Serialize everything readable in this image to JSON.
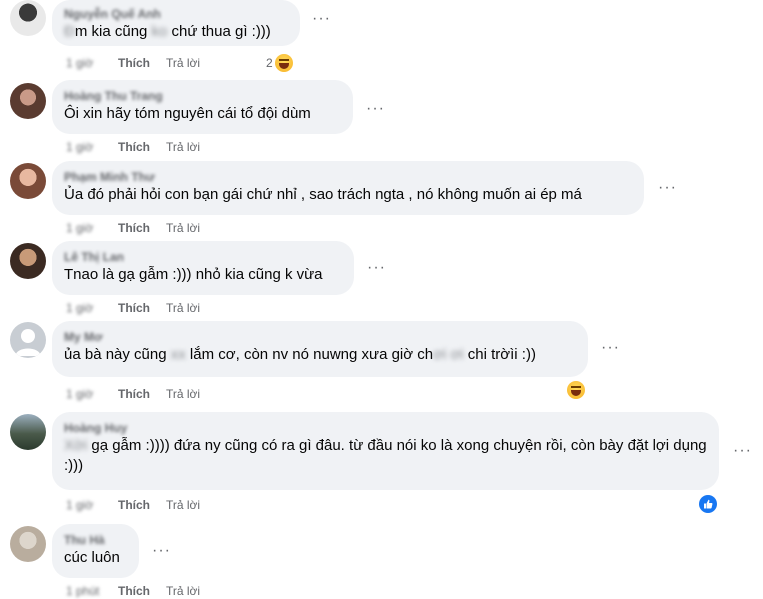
{
  "icons": {
    "more": "more-options-icon",
    "haha": "haha-reaction-icon",
    "like": "like-reaction-icon"
  },
  "labels": {
    "like": "Thích",
    "reply": "Trả lời",
    "more": "···"
  },
  "comments": [
    {
      "name": "Nguyễn Quế Anh",
      "text_parts": [
        {
          "t": "Đ",
          "b": true
        },
        {
          "t": "m kia cũng ",
          "b": false
        },
        {
          "t": "ko",
          "b": true
        },
        {
          "t": " chứ thua gì :)))",
          "b": false
        }
      ],
      "time": "1 giờ",
      "reaction_count": "2"
    },
    {
      "name": "Hoàng Thu Trang",
      "text_parts": [
        {
          "t": "Ôi xin hãy tóm nguyên cái tổ đội dùm",
          "b": false
        }
      ],
      "time": "1 giờ"
    },
    {
      "name": "Phạm Minh Thư",
      "text_parts": [
        {
          "t": "Ủa đó phải hỏi con bạn gái chứ nhỉ , sao trách ngta , nó không muốn ai ép má",
          "b": false
        }
      ],
      "time": "1 giờ"
    },
    {
      "name": "Lê Thị Lan",
      "text_parts": [
        {
          "t": "Tnao là gạ gẫm :))) nhỏ kia cũng k vừa",
          "b": false
        }
      ],
      "time": "1 giờ"
    },
    {
      "name": "My Mơ",
      "text_parts": [
        {
          "t": "ủa bà này cũng ",
          "b": false
        },
        {
          "t": "xx",
          "b": true
        },
        {
          "t": " lắm cơ, còn nv nó nuwng xưa giờ ch",
          "b": false
        },
        {
          "t": "ơi ơi",
          "b": true
        },
        {
          "t": " chi trờìi :))",
          "b": false
        }
      ],
      "time": "1 giờ"
    },
    {
      "name": "Hoàng Huy",
      "text_parts": [
        {
          "t": "Xời",
          "b": true
        },
        {
          "t": " gạ gẫm :)))) đứa ny cũng có ra gì đâu. từ đầu nói ko là xong chuyện rồi, còn bày đặt lợi dụng :)))",
          "b": false
        }
      ],
      "time": "1 giờ"
    },
    {
      "name": "Thu Hà",
      "text_parts": [
        {
          "t": "cúc luôn",
          "b": false
        }
      ],
      "time": "1 phút"
    }
  ]
}
